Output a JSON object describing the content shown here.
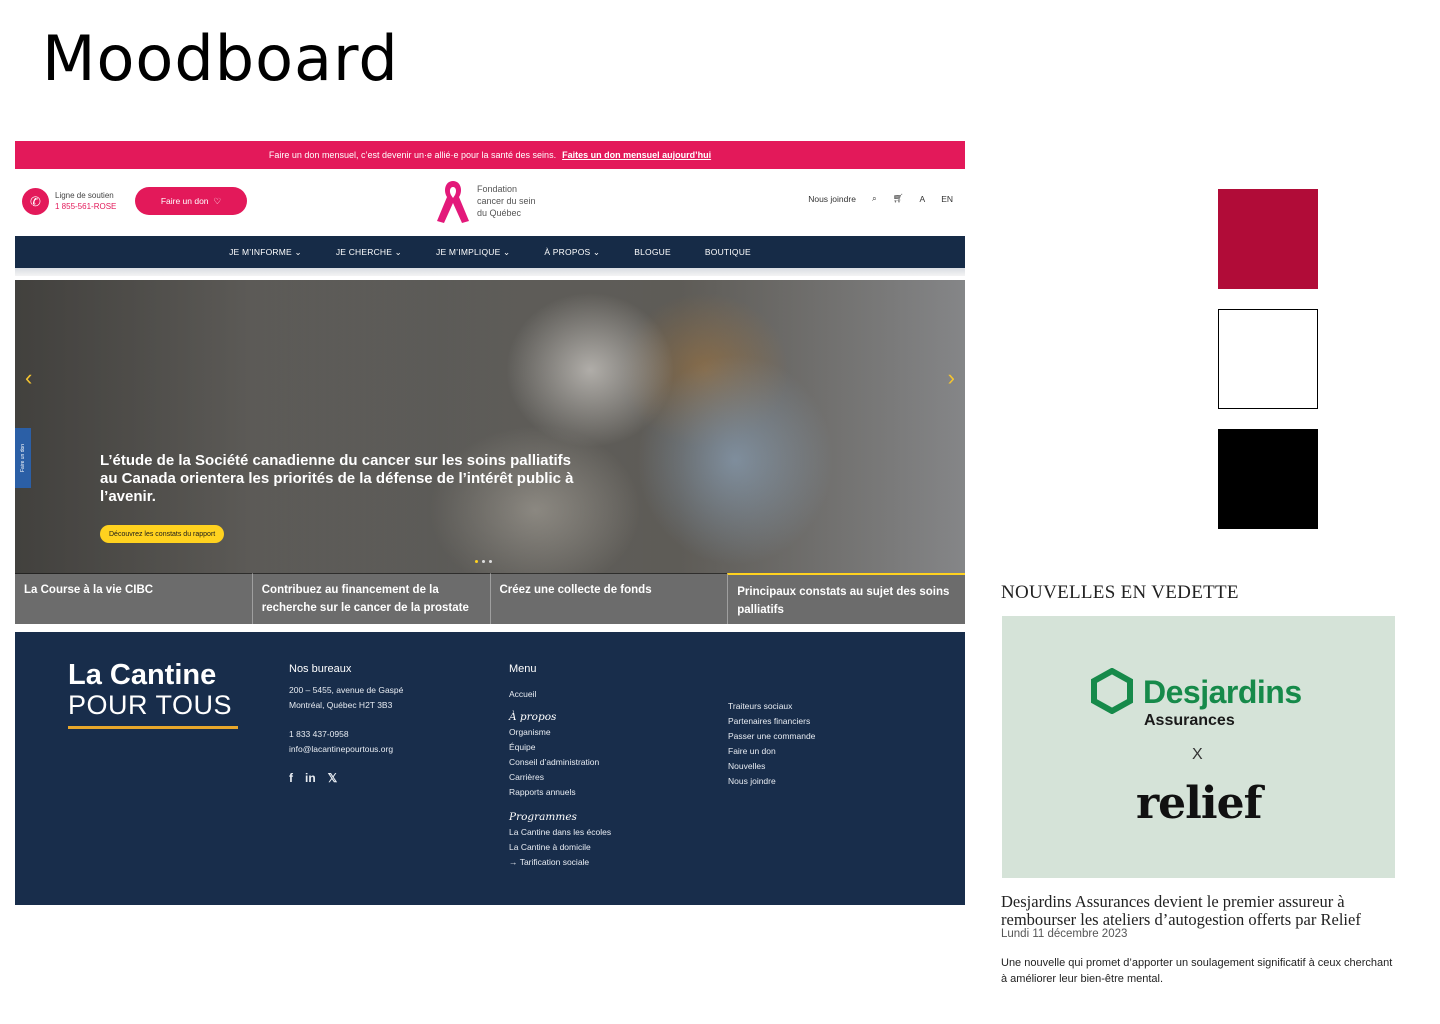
{
  "page": {
    "title": "Moodboard"
  },
  "site1": {
    "promo": {
      "text": "Faire un don mensuel, c’est devenir un·e allié·e pour la santé des seins.",
      "link": "Faites un don mensuel aujourd’hui"
    },
    "header": {
      "support_label": "Ligne de soutien",
      "support_number": "1 855-561-ROSE",
      "donate_button": "Faire un don",
      "logo_line1": "Fondation",
      "logo_line2": "cancer du sein",
      "logo_line3": "du Québec",
      "contact_link": "Nous joindre",
      "lang_toggle": "EN"
    },
    "nav": [
      "JE M’INFORME ⌄",
      "JE CHERCHE ⌄",
      "JE M’IMPLIQUE ⌄",
      "À PROPOS ⌄",
      "BLOGUE",
      "BOUTIQUE"
    ],
    "hero": {
      "title": "L’étude de la Société canadienne du cancer sur les soins palliatifs au Canada orientera les priorités de la défense de l’intérêt public à l’avenir.",
      "cta": "Découvrez les constats du rapport",
      "side_tab": "Faire un don"
    },
    "features": [
      "La Course à la vie CIBC",
      "Contribuez au financement de la recherche sur le cancer de la prostate",
      "Créez une collecte de fonds",
      "Principaux constats au sujet des soins palliatifs"
    ]
  },
  "site2": {
    "logo_line1": "La Cantine",
    "logo_line2": "POUR TOUS",
    "offices": {
      "heading": "Nos bureaux",
      "address1": "200 – 5455, avenue de Gaspé",
      "address2": "Montréal, Québec H2T 3B3",
      "phone": "1 833 437-0958",
      "email": "info@lacantinepourtous.org"
    },
    "social": [
      "f",
      "in",
      "𝕏"
    ],
    "menu": {
      "heading": "Menu",
      "home": "Accueil",
      "about_heading": "À propos",
      "about_items": [
        "Organisme",
        "Équipe",
        "Conseil d’administration",
        "Carrières",
        "Rapports annuels"
      ],
      "programs_heading": "Programmes",
      "program_items": [
        "La Cantine dans les écoles",
        "La Cantine à domicile",
        "→ Tarification sociale"
      ],
      "other_items": [
        "Traiteurs sociaux",
        "Partenaires financiers",
        "Passer une commande",
        "Faire un don",
        "Nouvelles",
        "Nous joindre"
      ]
    }
  },
  "palette": {
    "red": "#b10c38",
    "white": "#ffffff",
    "black": "#000000"
  },
  "news": {
    "heading": "NOUVELLES EN VEDETTE",
    "image_brand": "Desjardins",
    "image_sub": "Assurances",
    "image_x": "X",
    "image_partner": "relief",
    "title": "Desjardins Assurances devient le premier assureur à rembourser les ateliers d’autogestion offerts par Relief",
    "date": "Lundi 11 décembre 2023",
    "description": "Une nouvelle qui promet d’apporter un soulagement significatif à ceux cherchant à améliorer leur bien-être mental."
  }
}
